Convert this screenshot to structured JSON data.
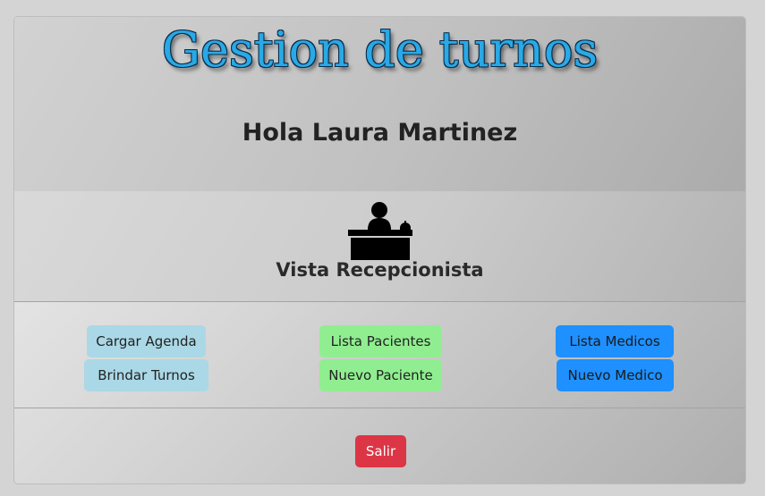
{
  "header": {
    "title": "Gestion de turnos",
    "greeting": "Hola Laura Martinez"
  },
  "view": {
    "icon": "receptionist-desk-icon",
    "title": "Vista Recepcionista"
  },
  "actions": {
    "cargar_agenda": "Cargar Agenda",
    "brindar_turnos": "Brindar Turnos",
    "lista_pacientes": "Lista Pacientes",
    "nuevo_paciente": "Nuevo Paciente",
    "lista_medicos": "Lista Medicos",
    "nuevo_medico": "Nuevo Medico"
  },
  "logout": {
    "label": "Salir"
  },
  "colors": {
    "title": "#29a9e6",
    "light_button": "#aad8e6",
    "green_button": "#90ee90",
    "blue_button": "#1e90ff",
    "danger_button": "#dc3545"
  }
}
